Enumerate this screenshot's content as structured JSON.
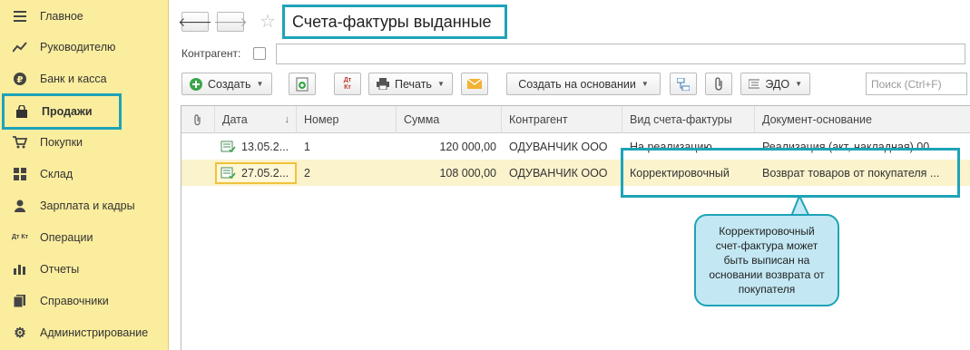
{
  "sidebar": {
    "items": [
      {
        "icon": "menu-icon",
        "label": "Главное"
      },
      {
        "icon": "trend-icon",
        "label": "Руководителю"
      },
      {
        "icon": "ruble-icon",
        "label": "Банк и касса"
      },
      {
        "icon": "bag-icon",
        "label": "Продажи"
      },
      {
        "icon": "cart-icon",
        "label": "Покупки"
      },
      {
        "icon": "warehouse-icon",
        "label": "Склад"
      },
      {
        "icon": "person-icon",
        "label": "Зарплата и кадры"
      },
      {
        "icon": "dtkt-icon",
        "label": "Операции"
      },
      {
        "icon": "chart-icon",
        "label": "Отчеты"
      },
      {
        "icon": "book-icon",
        "label": "Справочники"
      },
      {
        "icon": "gear-icon",
        "label": "Администрирование"
      }
    ],
    "active": "Продажи"
  },
  "header": {
    "title": "Счета-фактуры выданные"
  },
  "filter": {
    "label": "Контрагент:"
  },
  "toolbar": {
    "create": "Создать",
    "print": "Печать",
    "create_based": "Создать на основании",
    "edo": "ЭДО",
    "search_placeholder": "Поиск (Ctrl+F)",
    "dtkt": "Дт Кт"
  },
  "table": {
    "columns": [
      "Дата",
      "Номер",
      "Сумма",
      "Контрагент",
      "Вид счета-фактуры",
      "Документ-основание"
    ],
    "rows": [
      {
        "date": "13.05.2...",
        "number": "1",
        "sum": "120 000,00",
        "counterparty": "ОДУВАНЧИК ООО",
        "kind": "На реализацию",
        "basis": "Реализация (акт, накладная) 00..."
      },
      {
        "date": "27.05.2...",
        "number": "2",
        "sum": "108 000,00",
        "counterparty": "ОДУВАНЧИК ООО",
        "kind": "Корректировочный",
        "basis": "Возврат товаров от покупателя ..."
      }
    ]
  },
  "callout": {
    "text": "Корректировочный счет-фактура может быть выписан на основании возврата от покупателя"
  },
  "colors": {
    "sidebar_bg": "#fbed9e",
    "accent": "#1ea3b8",
    "selected_row": "#fbf3cc"
  }
}
